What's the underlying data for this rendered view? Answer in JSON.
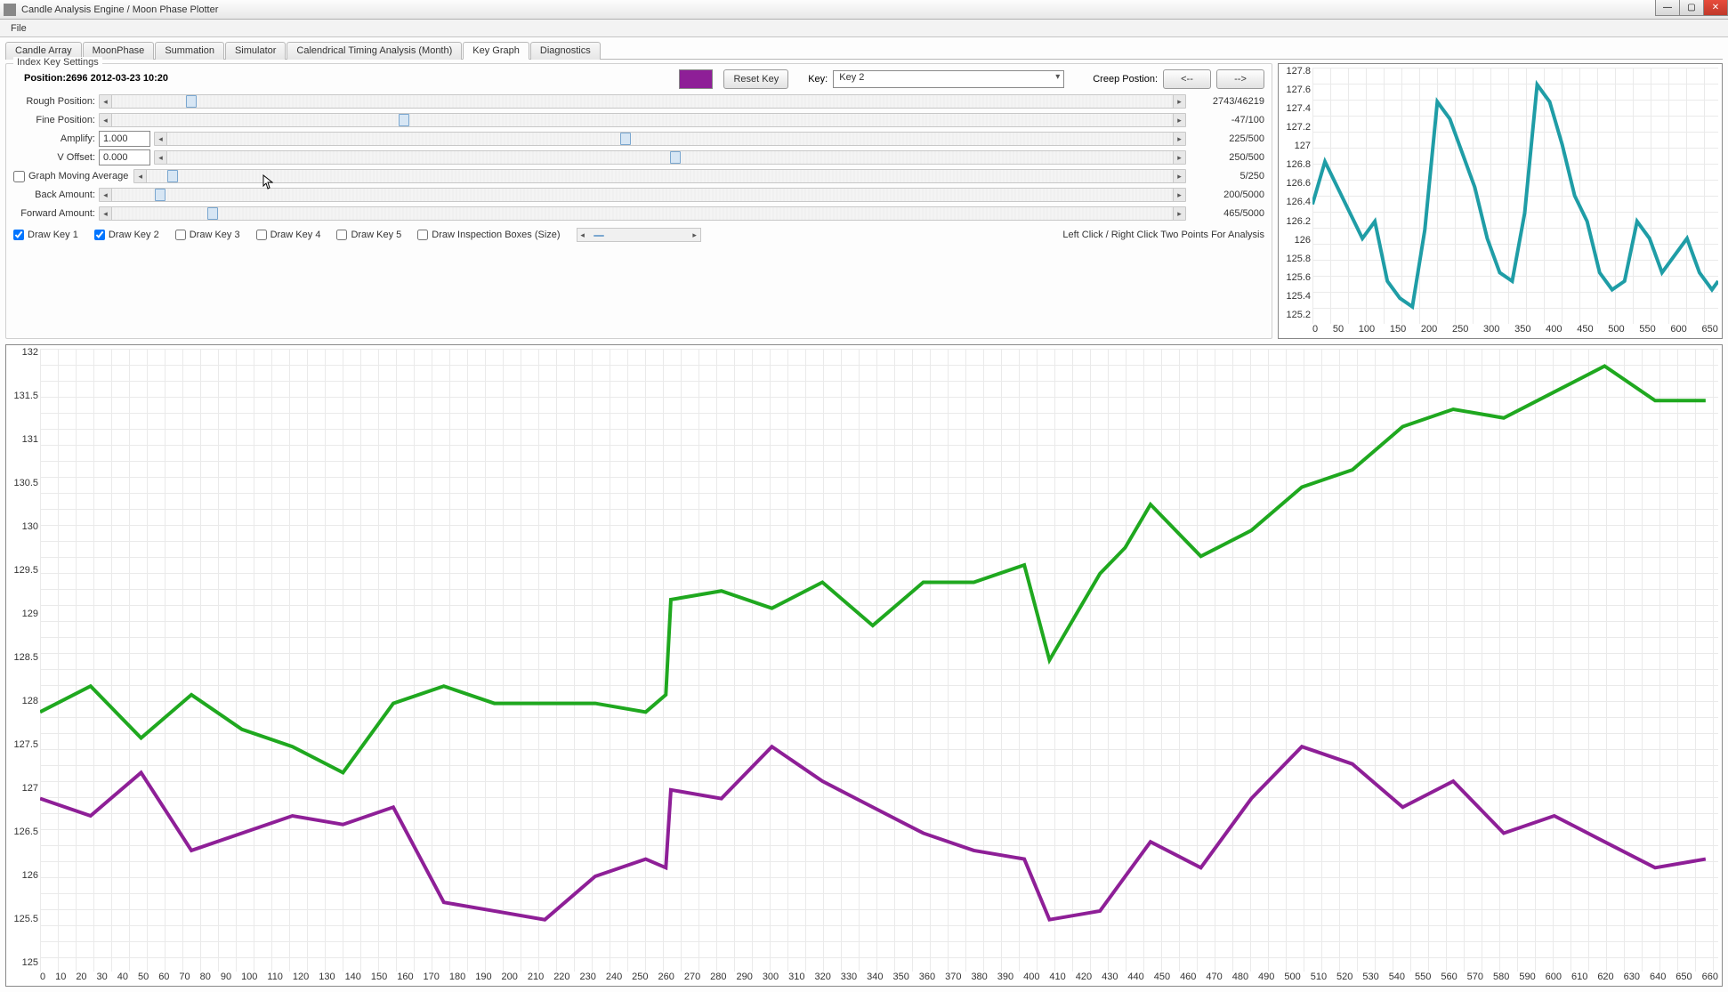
{
  "window": {
    "title": "Candle Analysis Engine / Moon Phase Plotter"
  },
  "menu": {
    "file": "File"
  },
  "tabs": [
    {
      "label": "Candle Array"
    },
    {
      "label": "MoonPhase"
    },
    {
      "label": "Summation"
    },
    {
      "label": "Simulator"
    },
    {
      "label": "Calendrical Timing Analysis (Month)"
    },
    {
      "label": "Key Graph",
      "active": true
    },
    {
      "label": "Diagnostics"
    }
  ],
  "panel": {
    "title": "Index Key Settings",
    "position_line": "Position:2696 2012-03-23 10:20",
    "color_hex": "#8e1f97",
    "reset_btn": "Reset Key",
    "key_label": "Key:",
    "key_value": "Key 2",
    "creep_label": "Creep Postion:",
    "creep_left": "<--",
    "creep_right": "-->",
    "rows": {
      "rough": {
        "label": "Rough Position:",
        "readout": "2743/46219",
        "thumb_pct": 7
      },
      "fine": {
        "label": "Fine Position:",
        "readout": "-47/100",
        "thumb_pct": 27
      },
      "amplify": {
        "label": "Amplify:",
        "value": "1.000",
        "readout": "225/500",
        "thumb_pct": 45
      },
      "voffset": {
        "label": "V Offset:",
        "value": "0.000",
        "readout": "250/500",
        "thumb_pct": 50
      },
      "gma": {
        "label": "Graph Moving Average",
        "checked": false,
        "readout": "5/250",
        "thumb_pct": 2
      },
      "back": {
        "label": "Back Amount:",
        "readout": "200/5000",
        "thumb_pct": 4
      },
      "forward": {
        "label": "Forward Amount:",
        "readout": "465/5000",
        "thumb_pct": 9
      }
    },
    "checks": {
      "k1": {
        "label": "Draw Key 1",
        "checked": true
      },
      "k2": {
        "label": "Draw Key 2",
        "checked": true
      },
      "k3": {
        "label": "Draw Key 3",
        "checked": false
      },
      "k4": {
        "label": "Draw Key 4",
        "checked": false
      },
      "k5": {
        "label": "Draw Key 5",
        "checked": false
      },
      "insp": {
        "label": "Draw Inspection Boxes (Size)",
        "checked": false
      }
    },
    "hint": "Left Click / Right Click Two Points For Analysis"
  },
  "chart_data": [
    {
      "type": "line",
      "role": "preview",
      "x_range": [
        0,
        650
      ],
      "y_range": [
        125,
        128
      ],
      "y_ticks": [
        127.8,
        127.6,
        127.4,
        127.2,
        127,
        126.8,
        126.6,
        126.4,
        126.2,
        126,
        125.8,
        125.6,
        125.4,
        125.2
      ],
      "x_ticks": [
        0,
        50,
        100,
        150,
        200,
        250,
        300,
        350,
        400,
        450,
        500,
        550,
        600,
        650
      ],
      "series": [
        {
          "name": "Key 2",
          "color": "#1f9da6",
          "values": [
            [
              0,
              126.4
            ],
            [
              20,
              126.9
            ],
            [
              40,
              126.6
            ],
            [
              60,
              126.3
            ],
            [
              80,
              126.0
            ],
            [
              100,
              126.2
            ],
            [
              120,
              125.5
            ],
            [
              140,
              125.3
            ],
            [
              160,
              125.2
            ],
            [
              180,
              126.1
            ],
            [
              200,
              127.6
            ],
            [
              220,
              127.4
            ],
            [
              240,
              127.0
            ],
            [
              260,
              126.6
            ],
            [
              280,
              126.0
            ],
            [
              300,
              125.6
            ],
            [
              320,
              125.5
            ],
            [
              340,
              126.3
            ],
            [
              360,
              127.8
            ],
            [
              380,
              127.6
            ],
            [
              400,
              127.1
            ],
            [
              420,
              126.5
            ],
            [
              440,
              126.2
            ],
            [
              460,
              125.6
            ],
            [
              480,
              125.4
            ],
            [
              500,
              125.5
            ],
            [
              520,
              126.2
            ],
            [
              540,
              126.0
            ],
            [
              560,
              125.6
            ],
            [
              580,
              125.8
            ],
            [
              600,
              126.0
            ],
            [
              620,
              125.6
            ],
            [
              640,
              125.4
            ],
            [
              650,
              125.5
            ]
          ]
        }
      ]
    },
    {
      "type": "line",
      "role": "main",
      "x_range": [
        0,
        665
      ],
      "y_range": [
        125,
        132.2
      ],
      "y_ticks": [
        132,
        131.5,
        131,
        130.5,
        130,
        129.5,
        129,
        128.5,
        128,
        127.5,
        127,
        126.5,
        126,
        125.5,
        125
      ],
      "x_ticks": [
        0,
        10,
        20,
        30,
        40,
        50,
        60,
        70,
        80,
        90,
        100,
        110,
        120,
        130,
        140,
        150,
        160,
        170,
        180,
        190,
        200,
        210,
        220,
        230,
        240,
        250,
        260,
        270,
        280,
        290,
        300,
        310,
        320,
        330,
        340,
        350,
        360,
        370,
        380,
        390,
        400,
        410,
        420,
        430,
        440,
        450,
        460,
        470,
        480,
        490,
        500,
        510,
        520,
        530,
        540,
        550,
        560,
        570,
        580,
        590,
        600,
        610,
        620,
        630,
        640,
        650,
        660
      ],
      "series": [
        {
          "name": "Key 1",
          "color": "#1fa81f",
          "values": [
            [
              0,
              128.0
            ],
            [
              20,
              128.3
            ],
            [
              40,
              127.7
            ],
            [
              60,
              128.2
            ],
            [
              80,
              127.8
            ],
            [
              100,
              127.6
            ],
            [
              120,
              127.3
            ],
            [
              140,
              128.1
            ],
            [
              160,
              128.3
            ],
            [
              180,
              128.1
            ],
            [
              200,
              128.1
            ],
            [
              220,
              128.1
            ],
            [
              240,
              128.0
            ],
            [
              248,
              128.2
            ],
            [
              250,
              129.3
            ],
            [
              270,
              129.4
            ],
            [
              290,
              129.2
            ],
            [
              310,
              129.5
            ],
            [
              330,
              129.0
            ],
            [
              350,
              129.5
            ],
            [
              370,
              129.5
            ],
            [
              390,
              129.7
            ],
            [
              400,
              128.6
            ],
            [
              410,
              129.1
            ],
            [
              420,
              129.6
            ],
            [
              430,
              129.9
            ],
            [
              440,
              130.4
            ],
            [
              460,
              129.8
            ],
            [
              480,
              130.1
            ],
            [
              500,
              130.6
            ],
            [
              520,
              130.8
            ],
            [
              540,
              131.3
            ],
            [
              560,
              131.5
            ],
            [
              580,
              131.4
            ],
            [
              600,
              131.7
            ],
            [
              620,
              132.0
            ],
            [
              640,
              131.6
            ],
            [
              660,
              131.6
            ]
          ]
        },
        {
          "name": "Key 2",
          "color": "#8e1f97",
          "values": [
            [
              0,
              127.0
            ],
            [
              20,
              126.8
            ],
            [
              40,
              127.3
            ],
            [
              60,
              126.4
            ],
            [
              80,
              126.6
            ],
            [
              100,
              126.8
            ],
            [
              120,
              126.7
            ],
            [
              140,
              126.9
            ],
            [
              160,
              125.8
            ],
            [
              180,
              125.7
            ],
            [
              200,
              125.6
            ],
            [
              220,
              126.1
            ],
            [
              240,
              126.3
            ],
            [
              248,
              126.2
            ],
            [
              250,
              127.1
            ],
            [
              270,
              127.0
            ],
            [
              290,
              127.6
            ],
            [
              310,
              127.2
            ],
            [
              330,
              126.9
            ],
            [
              350,
              126.6
            ],
            [
              370,
              126.4
            ],
            [
              390,
              126.3
            ],
            [
              400,
              125.6
            ],
            [
              420,
              125.7
            ],
            [
              440,
              126.5
            ],
            [
              460,
              126.2
            ],
            [
              480,
              127.0
            ],
            [
              500,
              127.6
            ],
            [
              520,
              127.4
            ],
            [
              540,
              126.9
            ],
            [
              560,
              127.2
            ],
            [
              580,
              126.6
            ],
            [
              600,
              126.8
            ],
            [
              620,
              126.5
            ],
            [
              640,
              126.2
            ],
            [
              660,
              126.3
            ]
          ]
        }
      ]
    }
  ]
}
